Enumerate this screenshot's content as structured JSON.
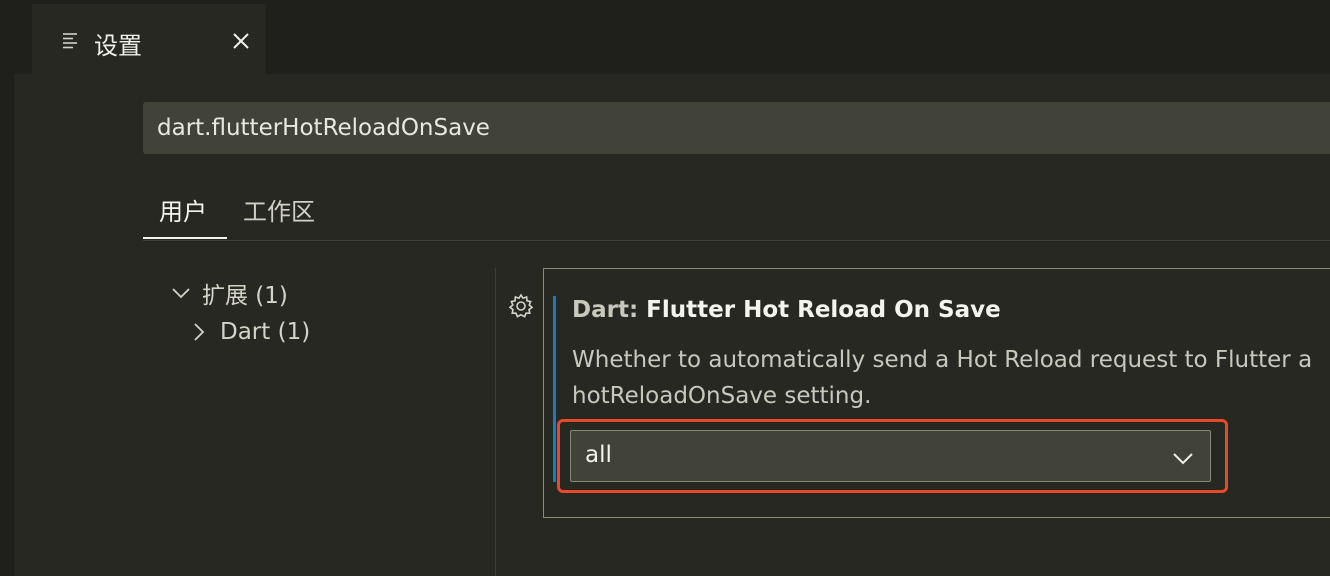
{
  "editor": {
    "tab_title": "设置",
    "tab_icon": "settings-list-icon",
    "close_icon": "close-icon"
  },
  "search": {
    "value": "dart.flutterHotReloadOnSave"
  },
  "scope_tabs": {
    "user": "用户",
    "workspace": "工作区",
    "active": "用户"
  },
  "toc": {
    "extensions": "扩展 (1)",
    "dart": "Dart (1)"
  },
  "setting": {
    "category": "Dart: ",
    "name": "Flutter Hot Reload On Save",
    "description_line1": "Whether to automatically send a Hot Reload request to Flutter a",
    "description_line2": "hotReloadOnSave setting.",
    "value": "all",
    "gear_icon": "gear-icon"
  },
  "colors": {
    "focus_bar": "#1e7ab8",
    "highlight": "#e8492b"
  }
}
